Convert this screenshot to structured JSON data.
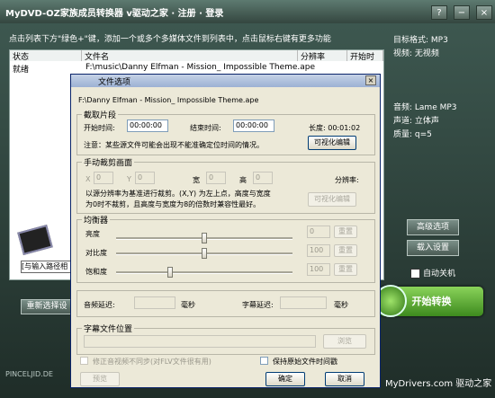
{
  "app": {
    "title": "MyDVD-OZ家族成员转换器 v驱动之家 · 注册 · 登录",
    "help_text": "点击列表下方\"绿色+\"键，添加一个或多个多媒体文件到列表中，点击鼠标右键有更多功能"
  },
  "window_buttons": {
    "help": "?",
    "minimize": "−",
    "close": "×"
  },
  "list": {
    "headers": [
      "状态",
      "文件名",
      "分辨率",
      "开始时"
    ],
    "rows": [
      {
        "status": "就绪",
        "file": "F:\\music\\Danny Elfman - Mission_ Impossible Theme.ape"
      }
    ]
  },
  "right_panel": {
    "target_format": "目标格式: MP3",
    "video": "视频: 无视频",
    "audio": "音频: Lame MP3",
    "channels": "声道: 立体声",
    "quality": "质量: q=5",
    "advanced_button": "高级选项",
    "load_button": "载入设置",
    "auto_shutdown": "自动关机",
    "start_button": "开始转换"
  },
  "left_panel": {
    "output_label": "选择",
    "output_path": "[与输入路径相",
    "reset_button": "重新选择设"
  },
  "brand": "PINCELJID.DE",
  "watermark": "MyDrivers.com 驱动之家",
  "dialog": {
    "title": "文件选项",
    "file_path": "F:\\Danny Elfman - Mission_ Impossible Theme.ape",
    "clip": {
      "group": "截取片段",
      "start_label": "开始时间:",
      "start_value": "00:00:00",
      "end_label": "结束时间:",
      "end_value": "00:00:00",
      "length": "长度: 00:01:02",
      "note": "注意：某些源文件可能会出现不能准确定位时间的情况。",
      "visual_edit": "可视化编辑"
    },
    "crop": {
      "group": "手动裁剪画面",
      "x_label": "X",
      "x_value": "0",
      "y_label": "Y",
      "y_value": "0",
      "w_label": "宽",
      "w_value": "0",
      "h_label": "高",
      "h_value": "0",
      "res_label": "分辨率:",
      "desc1": "以源分辨率为基准进行裁剪。(X,Y) 为左上点，高度与宽度",
      "desc2": "为0时不裁剪，且高度与宽度为8的倍数时兼容性最好。",
      "visual_edit": "可视化编辑"
    },
    "eq": {
      "group": "均衡器",
      "brightness_label": "亮度",
      "brightness_value": "0",
      "contrast_label": "对比度",
      "contrast_value": "100",
      "saturation_label": "饱和度",
      "saturation_value": "100",
      "reset": "重置",
      "brightness_level": 0.5,
      "contrast_level": 0.5,
      "saturation_level": 0.3
    },
    "delay": {
      "audio_label": "音频延迟:",
      "audio_unit": "毫秒",
      "sub_label": "字幕延迟:",
      "sub_unit": "毫秒"
    },
    "subtitle": {
      "group": "字幕文件位置",
      "browse": "浏览"
    },
    "fix_av": "修正音视频不同步(对FLV文件很有用)",
    "keep_time": "保持原始文件时间戳",
    "preview": "预览",
    "ok": "确定",
    "cancel": "取消"
  }
}
